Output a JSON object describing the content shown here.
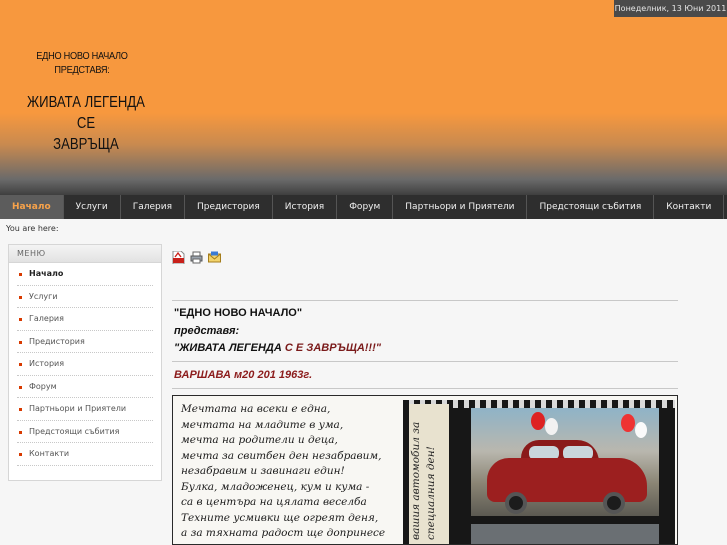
{
  "header": {
    "date": "Понеделник, 13 Юни 2011",
    "logo_line1": "ЕДНО НОВО НАЧАЛО",
    "logo_line2": "ПРЕДСТАВЯ:",
    "logo_main1": "ЖИВАТА ЛЕГЕНДА СЕ",
    "logo_main2": "ЗАВРЪЩА"
  },
  "nav": {
    "items": [
      {
        "label": "Начало"
      },
      {
        "label": "Услуги"
      },
      {
        "label": "Галерия"
      },
      {
        "label": "Предистория"
      },
      {
        "label": "История"
      },
      {
        "label": "Форум"
      },
      {
        "label": "Партньори и Приятели"
      },
      {
        "label": "Предстоящи събития"
      },
      {
        "label": "Контакти"
      }
    ],
    "active_index": 0
  },
  "breadcrumb": "You are here:",
  "menu": {
    "title": "МЕНЮ",
    "items": [
      {
        "label": "Начало"
      },
      {
        "label": "Услуги"
      },
      {
        "label": "Галерия"
      },
      {
        "label": "Предистория"
      },
      {
        "label": "История"
      },
      {
        "label": "Форум"
      },
      {
        "label": "Партньори и Приятели"
      },
      {
        "label": "Предстоящи събития"
      },
      {
        "label": "Контакти"
      }
    ]
  },
  "toolbar": {
    "icons": [
      "pdf-icon",
      "print-icon",
      "email-icon"
    ]
  },
  "content": {
    "line1": "\"ЕДНО НОВО НАЧАЛО\"",
    "line2": "представя:",
    "line3a": "\"ЖИВАТА ЛЕГЕНДА ",
    "line3b": "С Е ЗАВРЪЩА!!!\"",
    "warsaw": "ВАРШАВА м20 201 1963г."
  },
  "poster": {
    "poem": [
      "Мечтата на всеки е една,",
      "мечтата на младите в ума,",
      "мечта на родители и деца,",
      "мечта за свитбен ден незабравим,",
      "незабравим и завинаги един!",
      "Булка, младоженец, кум и кума -",
      "са в центъра на цялата веселба",
      "Техните усмивки ще огреят деня,",
      "а за тяхната радост ще допринесе"
    ],
    "side_text": "вашия автомобил за специалния ден!"
  },
  "colors": {
    "header_orange": "#f7983e",
    "nav_bg": "#2e2e2e",
    "nav_active_text": "#f7a24a",
    "accent_red": "#8c1c1c"
  }
}
